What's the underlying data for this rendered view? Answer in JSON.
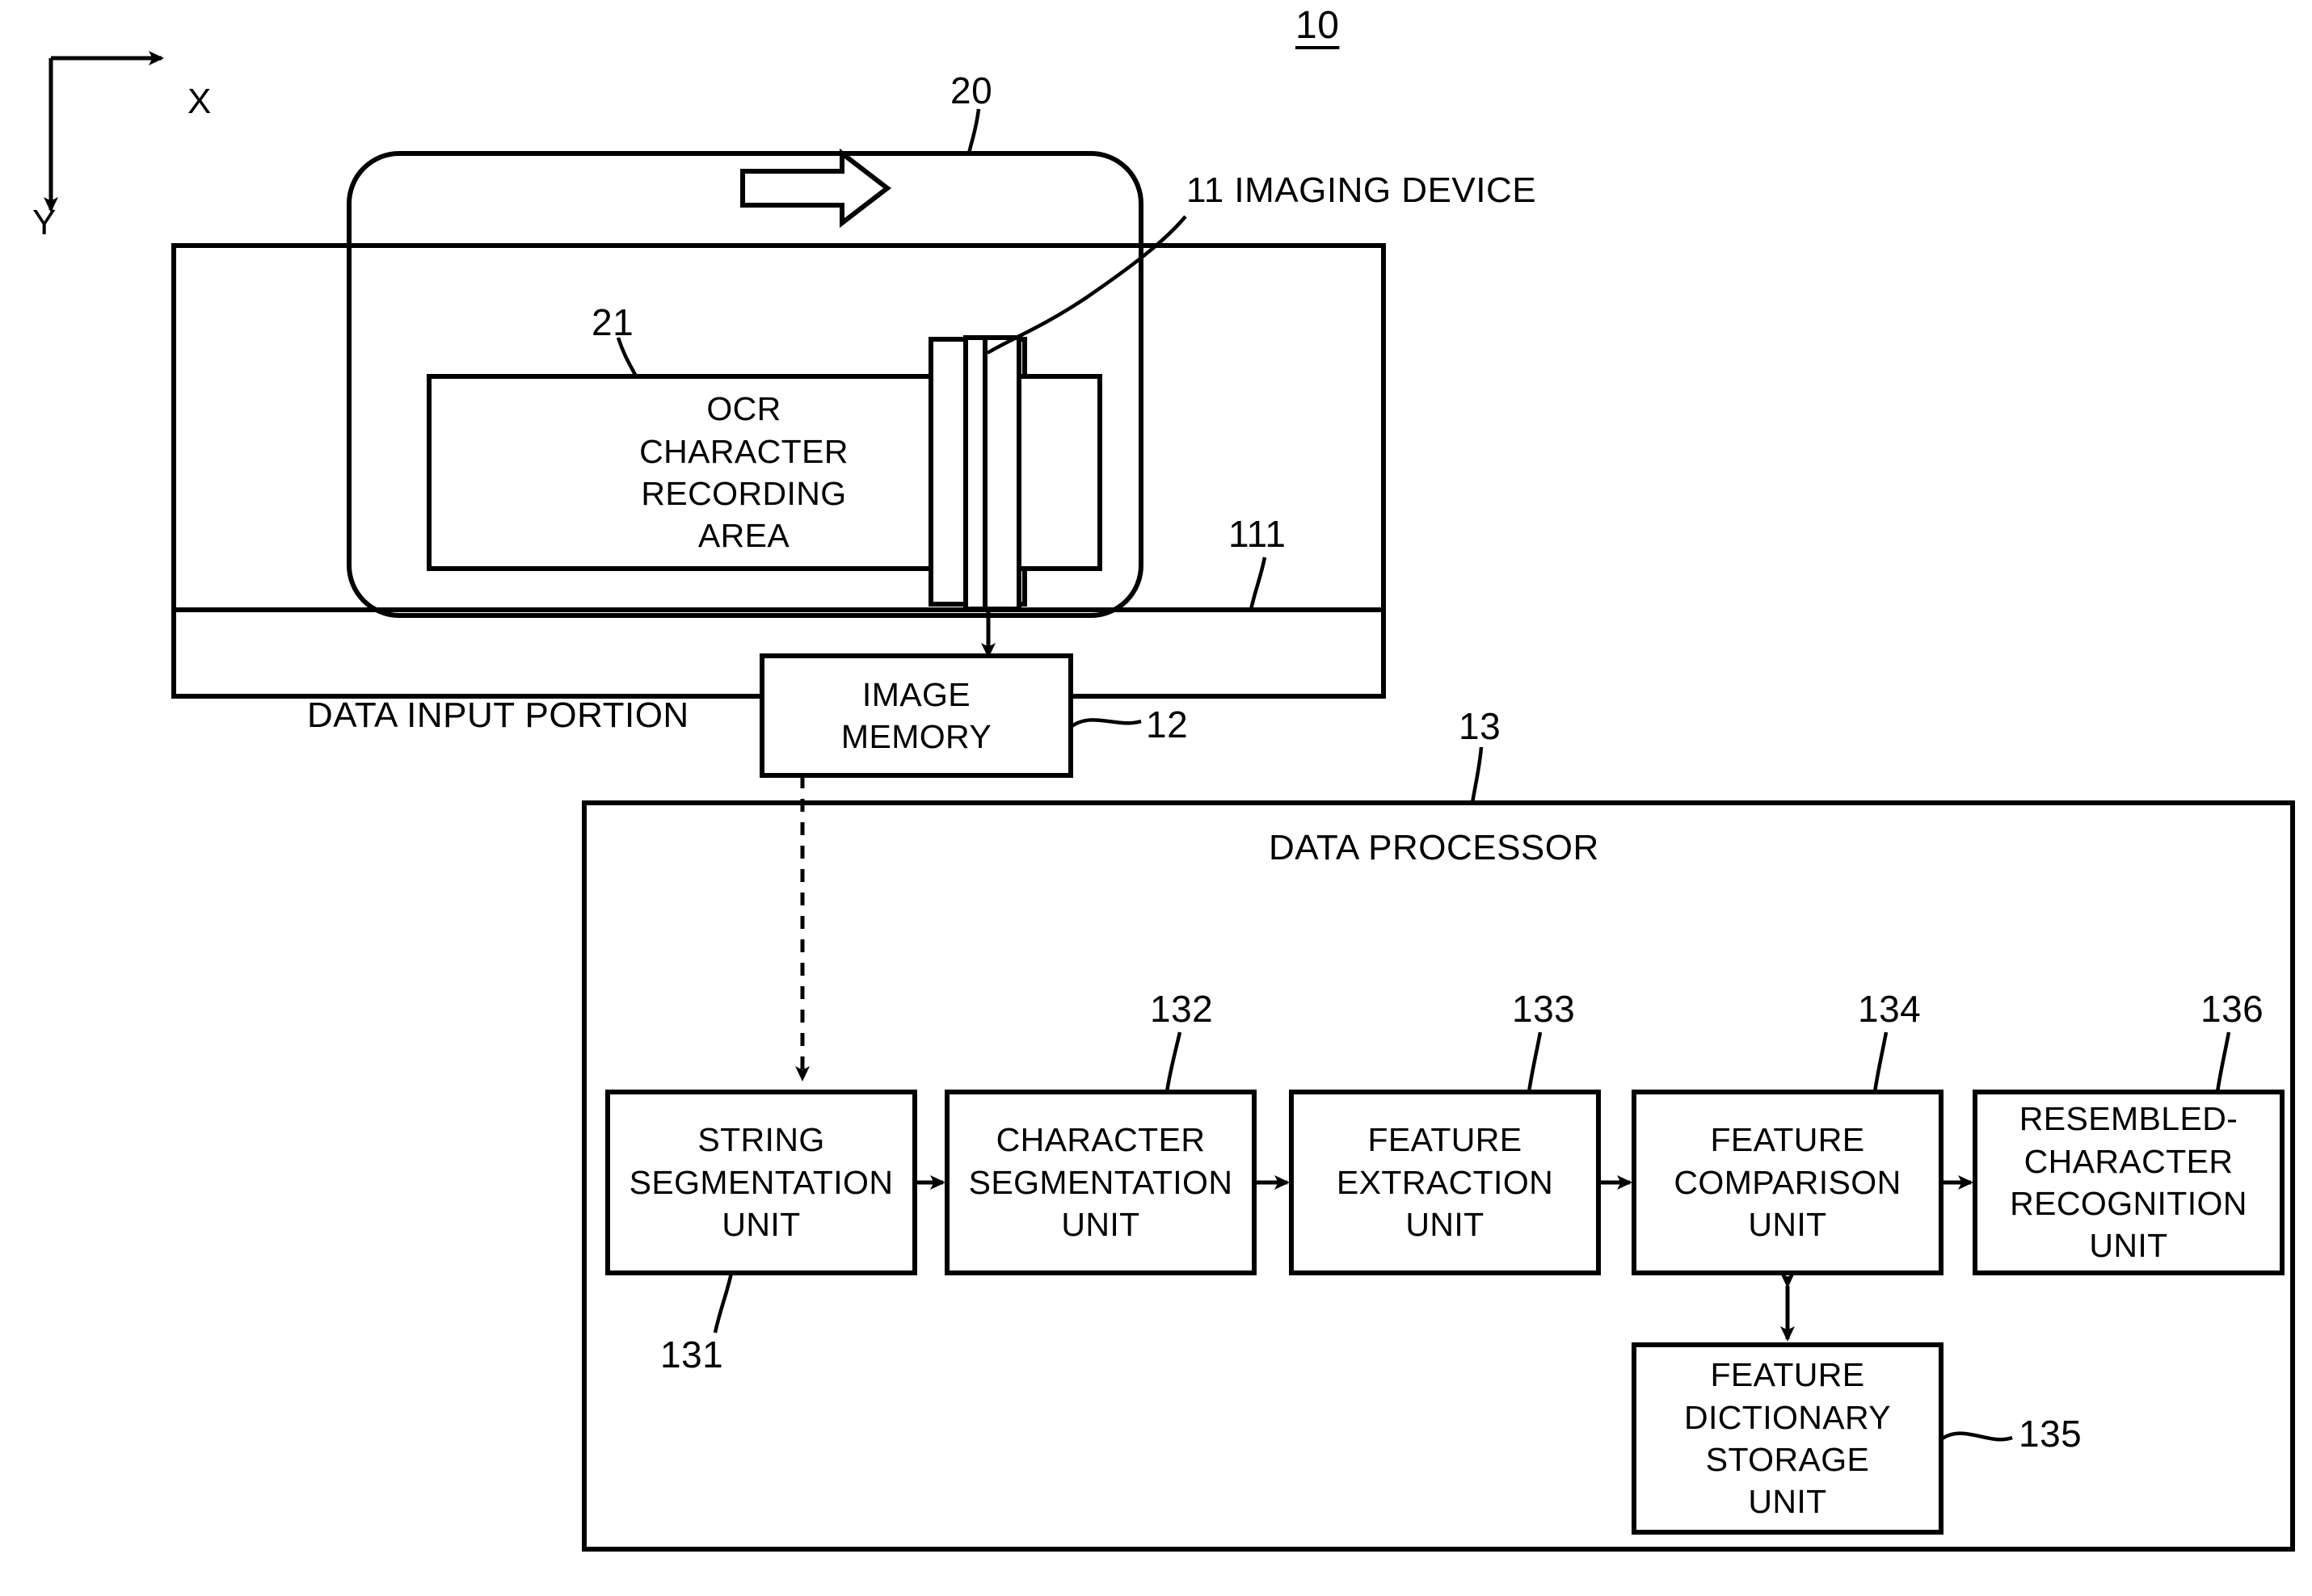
{
  "figure": {
    "number": "10",
    "axes": {
      "x_label": "X",
      "y_label": "Y"
    }
  },
  "refs": {
    "medium": "20",
    "ocr_area": "21",
    "imaging_device": "11 IMAGING DEVICE",
    "data_input_portion_inner": "111",
    "image_memory": "12",
    "data_processor": "13",
    "string_segmentation": "131",
    "character_segmentation": "132",
    "feature_extraction": "133",
    "feature_comparison": "134",
    "feature_dictionary": "135",
    "resembled_character": "136"
  },
  "blocks": {
    "ocr_area_label": "OCR\nCHARACTER\nRECORDING\nAREA",
    "data_input_portion_label": "DATA INPUT PORTION",
    "image_memory_label": "IMAGE\nMEMORY",
    "data_processor_label": "DATA PROCESSOR",
    "string_segmentation_label": "STRING\nSEGMENTATION\nUNIT",
    "character_segmentation_label": "CHARACTER\nSEGMENTATION\nUNIT",
    "feature_extraction_label": "FEATURE\nEXTRACTION\nUNIT",
    "feature_comparison_label": "FEATURE\nCOMPARISON\nUNIT",
    "resembled_character_label": "RESEMBLED-\nCHARACTER\nRECOGNITION\nUNIT",
    "feature_dictionary_label": "FEATURE\nDICTIONARY\nSTORAGE\nUNIT"
  },
  "colors": {
    "stroke": "#000000",
    "background": "#ffffff"
  }
}
